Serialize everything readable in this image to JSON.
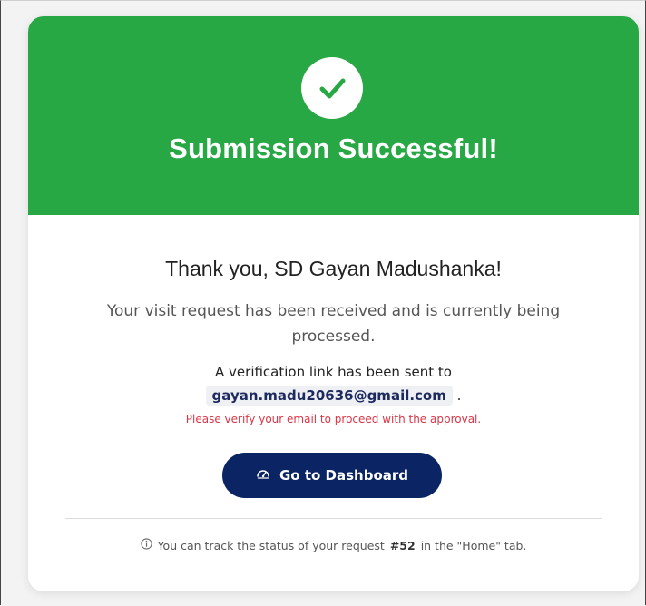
{
  "header": {
    "icon": "check-icon",
    "title": "Submission Successful!",
    "color": "#28a745"
  },
  "message": {
    "thanks": "Thank you, SD Gayan Madushanka!",
    "received": "Your visit request has been received and is currently being processed.",
    "verification_prefix": "A verification link has been sent to",
    "email": "gayan.madu20636@gmail.com",
    "email_suffix": ".",
    "warning": "Please verify your email to proceed with the approval."
  },
  "button": {
    "icon": "dashboard-gauge-icon",
    "label": "Go to Dashboard",
    "color": "#0b2463"
  },
  "footer": {
    "icon": "info-icon",
    "text_before": "You can track the status of your request",
    "request_id": "#52",
    "text_after": "in the \"Home\" tab."
  }
}
